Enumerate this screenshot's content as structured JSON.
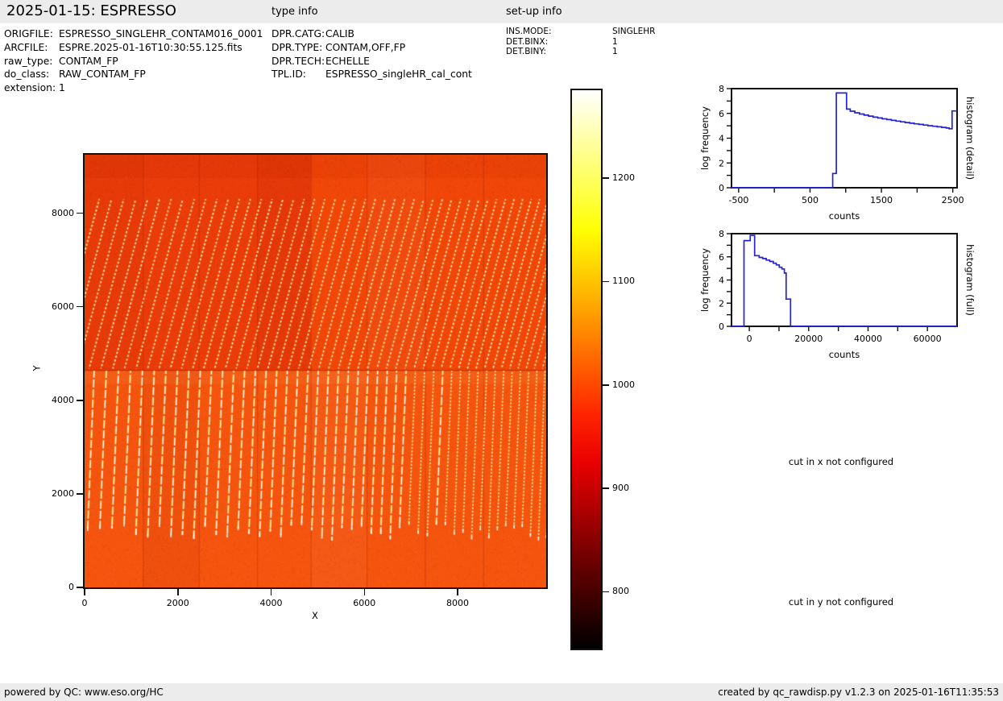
{
  "header": {
    "title": "2025-01-15: ESPRESSO",
    "type_info_label": "type info",
    "setup_info_label": "set-up info"
  },
  "file_info": {
    "rows": [
      {
        "label": "ORIGFILE:",
        "value": "ESPRESSO_SINGLEHR_CONTAM016_0001"
      },
      {
        "label": "ARCFILE:",
        "value": "ESPRE.2025-01-16T10:30:55.125.fits"
      },
      {
        "label": "raw_type:",
        "value": "CONTAM_FP"
      },
      {
        "label": "do_class:",
        "value": "RAW_CONTAM_FP"
      },
      {
        "label": "extension:",
        "value": "1"
      }
    ]
  },
  "type_info": {
    "rows": [
      {
        "label": "DPR.CATG:",
        "value": "CALIB"
      },
      {
        "label": "DPR.TYPE:",
        "value": "CONTAM,OFF,FP"
      },
      {
        "label": "DPR.TECH:",
        "value": "ECHELLE"
      },
      {
        "label": "TPL.ID:",
        "value": "ESPRESSO_singleHR_cal_cont"
      }
    ]
  },
  "setup_info": {
    "rows": [
      {
        "label": "INS.MODE:",
        "value": "SINGLEHR"
      },
      {
        "label": "DET.BINX:",
        "value": "1"
      },
      {
        "label": "DET.BINY:",
        "value": "1"
      }
    ]
  },
  "cuts": {
    "x": "cut in x not configured",
    "y": "cut in y not configured"
  },
  "footer": {
    "left": "powered by QC: www.eso.org/HC",
    "right": "created by qc_rawdisp.py v1.2.3 on 2025-01-16T11:35:53"
  },
  "chart_data": [
    {
      "type": "heatmap",
      "name": "raw-detector-image",
      "xlabel": "X",
      "ylabel": "Y",
      "x_range": [
        0,
        9900
      ],
      "y_range": [
        0,
        9250
      ],
      "x_ticks": [
        0,
        2000,
        4000,
        6000,
        8000
      ],
      "y_ticks": [
        0,
        2000,
        4000,
        6000,
        8000
      ],
      "colorbar": {
        "ticks": [
          800,
          900,
          1000,
          1100,
          1200
        ],
        "value_range": [
          745,
          1285
        ],
        "colormap": "hot"
      },
      "background_level_counts": 1000,
      "regions": {
        "top_plain": {
          "y": [
            8300,
            9250
          ]
        },
        "upper_fringes": {
          "y": [
            4650,
            8300
          ],
          "style": "dashed diagonal FP fringes",
          "tilt_dx": 1000,
          "spacing_range": [
            265,
            170
          ]
        },
        "boundary_line_y": 4650,
        "lower_fringes": {
          "y": [
            1100,
            4650
          ],
          "style": "bright near-vertical FP fringes",
          "tilt_dx": 140,
          "spacing_range": [
            265,
            170
          ]
        },
        "bottom_plain": {
          "y": [
            0,
            1100
          ]
        },
        "amp_boundaries_x": [
          1250,
          2450,
          3700,
          4850,
          6050,
          7300,
          8550
        ]
      },
      "palette": {
        "upper_left": "#ea3c09",
        "upper_right": "#f04608",
        "lower": "#f4540e",
        "fringe_core": "#ffffff",
        "fringe_halo": "#ffc032",
        "divider_line": "#aa2804"
      }
    },
    {
      "type": "line",
      "subtype": "histogram-step",
      "name": "histogram-detail",
      "right_label": "histogram (detail)",
      "xlabel": "counts",
      "ylabel": "log frequency",
      "x_range": [
        -600,
        2560
      ],
      "y_range": [
        0,
        8
      ],
      "x_ticks_labeled": [
        -500,
        500,
        1500,
        2500
      ],
      "x_ticks_all": [
        -500,
        0,
        500,
        1000,
        1500,
        2000,
        2500
      ],
      "y_ticks_labeled": [
        0,
        2,
        4,
        6,
        8
      ],
      "y_ticks_all": [
        0,
        1,
        2,
        3,
        4,
        5,
        6,
        7,
        8
      ],
      "line_color": "#2323d3",
      "steps": [
        [
          -600,
          0
        ],
        [
          818,
          1.15
        ],
        [
          868,
          7.65
        ],
        [
          1012,
          6.35
        ],
        [
          1064,
          6.18
        ],
        [
          1128,
          6.05
        ],
        [
          1192,
          5.95
        ],
        [
          1256,
          5.86
        ],
        [
          1320,
          5.78
        ],
        [
          1384,
          5.7
        ],
        [
          1448,
          5.63
        ],
        [
          1512,
          5.56
        ],
        [
          1576,
          5.5
        ],
        [
          1640,
          5.44
        ],
        [
          1704,
          5.38
        ],
        [
          1768,
          5.32
        ],
        [
          1832,
          5.26
        ],
        [
          1896,
          5.21
        ],
        [
          1960,
          5.16
        ],
        [
          2024,
          5.11
        ],
        [
          2088,
          5.06
        ],
        [
          2152,
          5.01
        ],
        [
          2216,
          4.96
        ],
        [
          2280,
          4.92
        ],
        [
          2344,
          4.87
        ],
        [
          2408,
          4.82
        ],
        [
          2448,
          4.76
        ],
        [
          2490,
          6.2
        ],
        [
          2560,
          6.2
        ]
      ]
    },
    {
      "type": "line",
      "subtype": "histogram-step",
      "name": "histogram-full",
      "right_label": "histogram (full)",
      "xlabel": "counts",
      "ylabel": "log frequency",
      "x_range": [
        -6000,
        70000
      ],
      "y_range": [
        0,
        8
      ],
      "x_ticks_labeled": [
        0,
        20000,
        40000,
        60000
      ],
      "x_ticks_all": [
        0,
        10000,
        20000,
        30000,
        40000,
        50000,
        60000
      ],
      "y_ticks_labeled": [
        0,
        2,
        4,
        6,
        8
      ],
      "y_ticks_all": [
        0,
        1,
        2,
        3,
        4,
        5,
        6,
        7,
        8
      ],
      "line_color": "#2323d3",
      "steps": [
        [
          -6000,
          0
        ],
        [
          -1800,
          7.4
        ],
        [
          300,
          7.85
        ],
        [
          1800,
          6.1
        ],
        [
          3300,
          5.95
        ],
        [
          4500,
          5.85
        ],
        [
          5700,
          5.72
        ],
        [
          6900,
          5.6
        ],
        [
          8100,
          5.45
        ],
        [
          9100,
          5.3
        ],
        [
          10100,
          5.1
        ],
        [
          11000,
          4.95
        ],
        [
          11800,
          4.6
        ],
        [
          12400,
          2.35
        ],
        [
          13900,
          0
        ],
        [
          70000,
          0
        ]
      ]
    }
  ]
}
